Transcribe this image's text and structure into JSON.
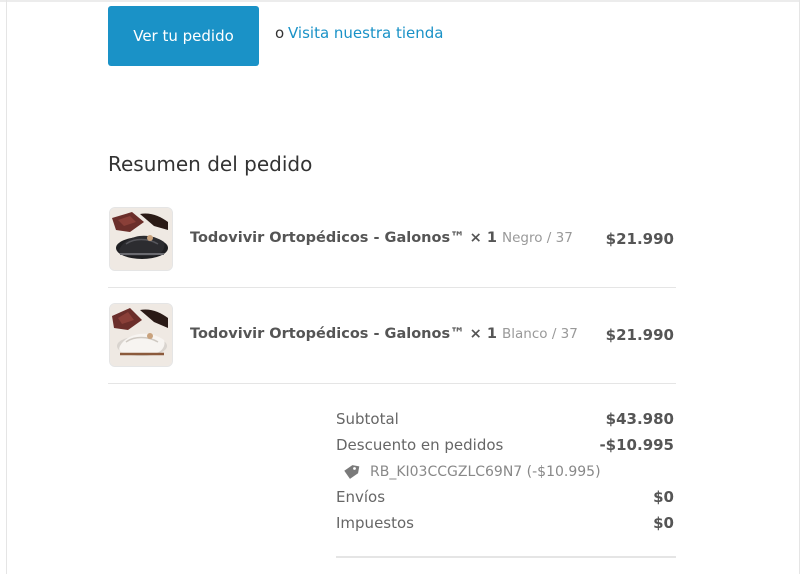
{
  "cta": {
    "button_label": "Ver tu pedido",
    "or_text": "o",
    "link_label": "Visita nuestra tienda"
  },
  "summary": {
    "title": "Resumen del pedido",
    "items": [
      {
        "name": "Todovivir Ortopédicos - Galonos™",
        "quantity": "× 1",
        "variant": "Negro / 37",
        "price": "$21.990",
        "image": "black-shoe-image"
      },
      {
        "name": "Todovivir Ortopédicos - Galonos™",
        "quantity": "× 1",
        "variant": "Blanco / 37",
        "price": "$21.990",
        "image": "white-shoe-image"
      }
    ]
  },
  "totals": {
    "subtotal_label": "Subtotal",
    "subtotal_value": "$43.980",
    "discount_label": "Descuento en pedidos",
    "discount_value": "-$10.995",
    "discount_code": "RB_KI03CCGZLC69N7 (-$10.995)",
    "shipping_label": "Envíos",
    "shipping_value": "$0",
    "taxes_label": "Impuestos",
    "taxes_value": "$0"
  },
  "colors": {
    "accent": "#1a92c7",
    "text": "#333333",
    "muted": "#999999",
    "divider": "#e5e5e5"
  }
}
